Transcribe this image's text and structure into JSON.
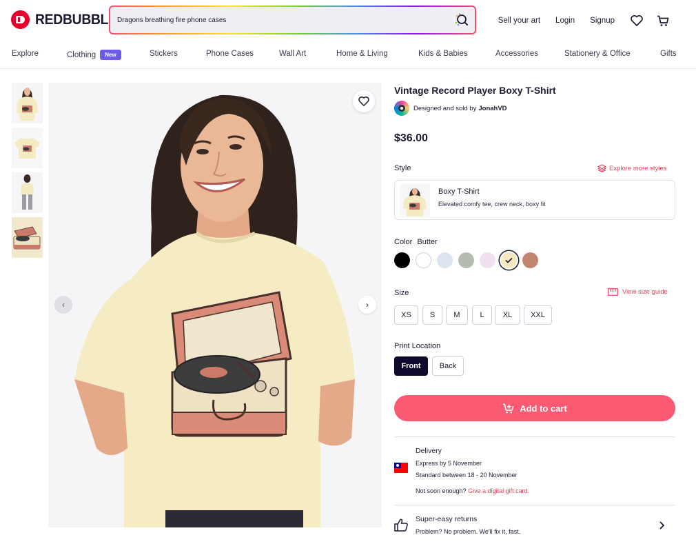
{
  "header": {
    "logo_text": "REDBUBBLE",
    "search_value": "Dragons breathing fire phone cases",
    "sell_label": "Sell your art",
    "login_label": "Login",
    "signup_label": "Signup"
  },
  "nav": {
    "items": [
      "Explore",
      "Clothing",
      "Stickers",
      "Phone Cases",
      "Wall Art",
      "Home & Living",
      "Kids & Babies",
      "Accessories",
      "Stationery & Office",
      "Gifts"
    ],
    "new_badge": "New"
  },
  "product": {
    "title": "Vintage Record Player Boxy T-Shirt",
    "designer_prefix": "Designed and sold by",
    "designer_name": "JonahVD",
    "price": "$36.00"
  },
  "style": {
    "label": "Style",
    "explore_link": "Explore more styles",
    "name": "Boxy T-Shirt",
    "description": "Elevated comfy tee, crew neck, boxy fit"
  },
  "color": {
    "label": "Color",
    "selected_name": "Butter",
    "swatches": [
      "#000000",
      "#ffffff",
      "#dde3ef",
      "#b4bcb2",
      "#f1e0f0",
      "#f4e8bf",
      "#c08670"
    ],
    "selected_index": 5
  },
  "size": {
    "label": "Size",
    "guide_link": "View size guide",
    "options": [
      "XS",
      "S",
      "M",
      "L",
      "XL",
      "XXL"
    ]
  },
  "print_location": {
    "label": "Print Location",
    "options": [
      "Front",
      "Back"
    ],
    "selected": "Front"
  },
  "cart": {
    "label": "Add to cart"
  },
  "delivery": {
    "title": "Delivery",
    "express": "Express by 5 November",
    "standard": "Standard between 18 - 20 November",
    "not_soon": "Not soon enough?",
    "gift_link": "Give a digital gift card."
  },
  "returns": {
    "title": "Super-easy returns",
    "text": "Problem? No problem. We'll fix it, fast."
  }
}
